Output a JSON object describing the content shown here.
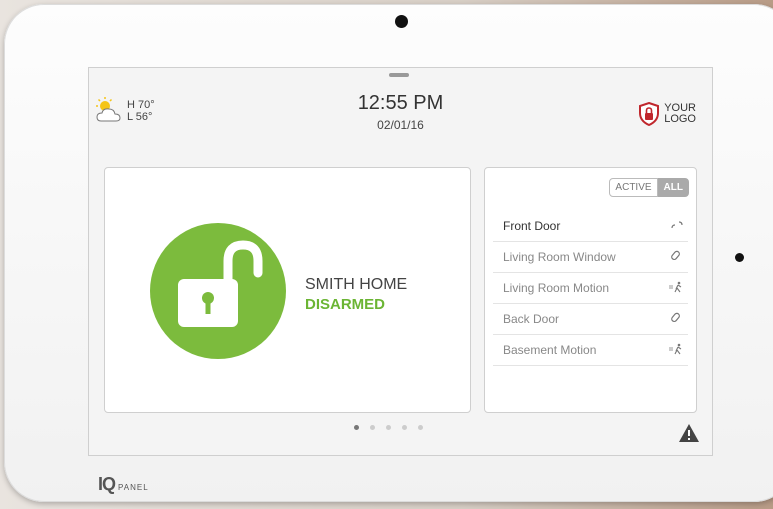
{
  "device": {
    "brand": "PANEL"
  },
  "weather": {
    "high": "H 70°",
    "low": "L 56°"
  },
  "clock": {
    "time": "12:55 PM",
    "date": "02/01/16"
  },
  "logo": {
    "line1": "YOUR",
    "line2": "LOGO",
    "accent": "#c0272d"
  },
  "security": {
    "home_name": "SMITH HOME",
    "state": "DISARMED",
    "accent": "#7cbb3d"
  },
  "filter": {
    "active_label": "ACTIVE",
    "all_label": "ALL"
  },
  "sensors": [
    {
      "name": "Front Door",
      "icon": "door-open-icon"
    },
    {
      "name": "Living Room Window",
      "icon": "link-icon"
    },
    {
      "name": "Living Room Motion",
      "icon": "motion-icon"
    },
    {
      "name": "Back Door",
      "icon": "link-icon"
    },
    {
      "name": "Basement Motion",
      "icon": "motion-icon"
    }
  ]
}
